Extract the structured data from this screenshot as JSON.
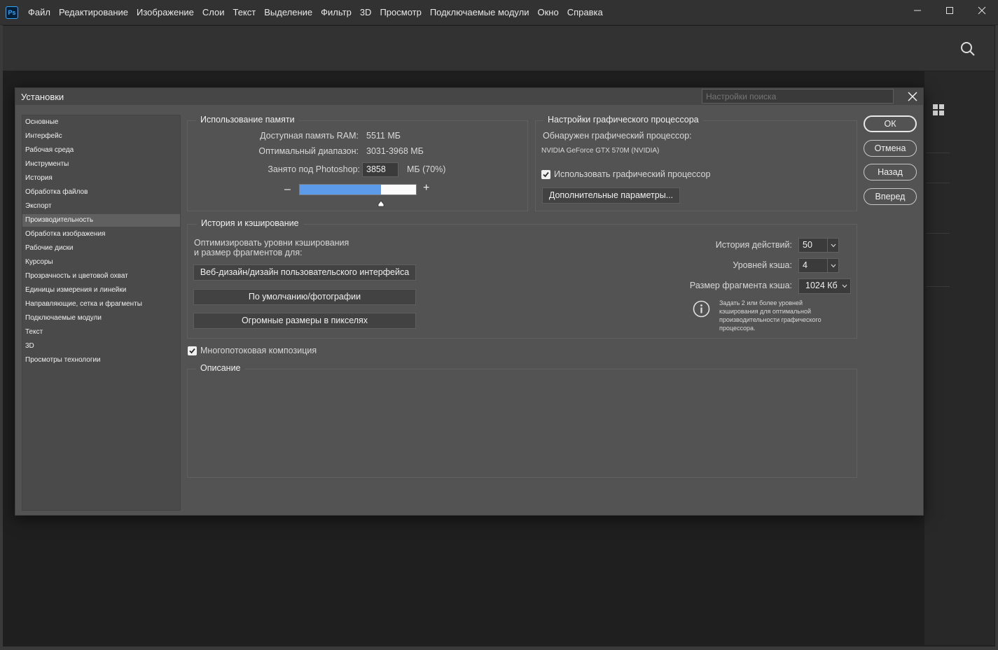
{
  "app": {
    "logo_text": "Ps",
    "menu": [
      "Файл",
      "Редактирование",
      "Изображение",
      "Слои",
      "Текст",
      "Выделение",
      "Фильтр",
      "3D",
      "Просмотр",
      "Подключаемые модули",
      "Окно",
      "Справка"
    ],
    "window_controls": [
      "minimize-icon",
      "maximize-icon",
      "close-icon"
    ]
  },
  "dialog": {
    "title": "Установки",
    "search_placeholder": "Настройки поиска",
    "nav": [
      "Основные",
      "Интерфейс",
      "Рабочая среда",
      "Инструменты",
      "История",
      "Обработка файлов",
      "Экспорт",
      "Производительность",
      "Обработка изображения",
      "Рабочие диски",
      "Курсоры",
      "Прозрачность и цветовой охват",
      "Единицы измерения и линейки",
      "Направляющие, сетка и фрагменты",
      "Подключаемые модули",
      "Текст",
      "3D",
      "Просмотры технологии"
    ],
    "nav_active_index": 7,
    "memory": {
      "title": "Использование памяти",
      "ram_label": "Доступная память RAM:",
      "ram_value": "5511 МБ",
      "range_label": "Оптимальный диапазон:",
      "range_value": "3031-3968 МБ",
      "used_label": "Занято под Photoshop:",
      "used_value": "3858",
      "used_suffix": "МБ (70%)",
      "used_fraction": 0.7,
      "minus": "–",
      "plus": "+"
    },
    "gpu": {
      "title": "Настройки графического процессора",
      "detected_label": "Обнаружен графический процессор:",
      "gpu_name": "NVIDIA GeForce GTX 570M (NVIDIA)",
      "use_gpu_label": "Использовать графический процессор",
      "use_gpu_checked": true,
      "advanced_button": "Дополнительные параметры..."
    },
    "cache": {
      "title": "История и кэширование",
      "optimize_line1": "Оптимизировать уровни кэширования",
      "optimize_line2": "и размер фрагментов для:",
      "preset_buttons": [
        "Веб-дизайн/дизайн пользовательского интерфейса",
        "По умолчанию/фотографии",
        "Огромные размеры в пикселях"
      ],
      "history_label": "История действий:",
      "history_value": "50",
      "levels_label": "Уровней кэша:",
      "levels_value": "4",
      "tile_label": "Размер фрагмента кэша:",
      "tile_value": "1024 Кб",
      "info_text": [
        "Задать 2 или более уровней",
        "кэширования для оптимальной",
        "производительности графического",
        "процессора."
      ]
    },
    "multithread_label": "Многопотоковая композиция",
    "multithread_checked": true,
    "description_title": "Описание",
    "buttons": {
      "ok": "ОК",
      "cancel": "Отмена",
      "back": "Назад",
      "forward": "Вперед"
    }
  }
}
